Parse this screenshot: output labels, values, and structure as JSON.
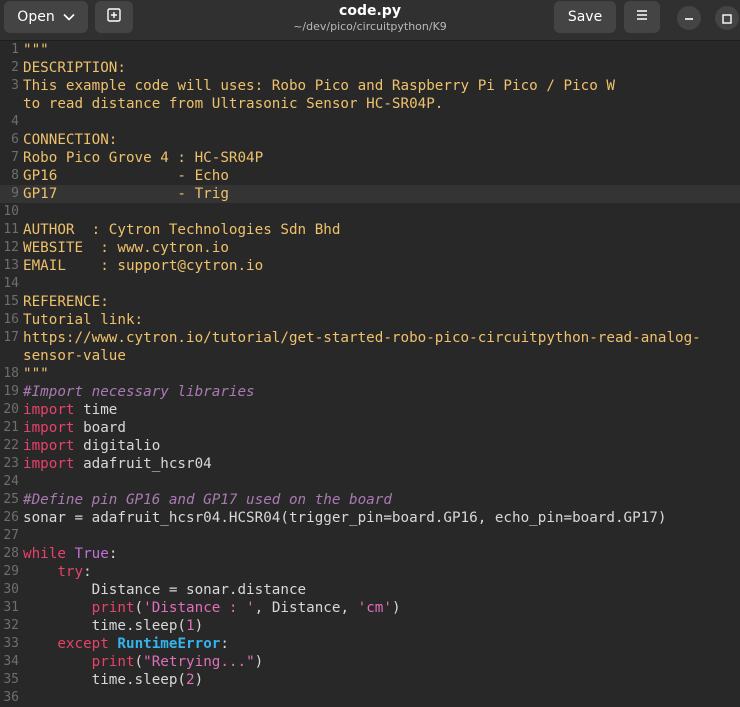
{
  "header": {
    "open_label": "Open",
    "save_label": "Save",
    "title": "code.py",
    "path": "~/dev/pico/circuitpython/K9"
  },
  "icons": {
    "open_dropdown": "chevron-down-icon",
    "new_tab": "new-tab-icon",
    "menu": "hamburger-menu-icon",
    "minimize": "minimize-icon",
    "maximize": "maximize-icon"
  },
  "colors": {
    "background": "#282828",
    "docstring": "#eec16c",
    "keyword": "#e8426a",
    "comment": "#a97ab2",
    "string": "#e070b8",
    "exception": "#33b4ec",
    "line_number": "#6e6e6e"
  },
  "editor": {
    "current_line": 9,
    "lines": [
      {
        "n": "1",
        "tokens": [
          {
            "t": "\"\"\"",
            "c": "doc"
          }
        ]
      },
      {
        "n": "2",
        "tokens": [
          {
            "t": "DESCRIPTION:",
            "c": "doc"
          }
        ]
      },
      {
        "n": "3",
        "tokens": [
          {
            "t": "This example code will uses: Robo Pico and Raspberry Pi Pico / Pico W",
            "c": "doc"
          }
        ]
      },
      {
        "n": "",
        "tokens": [
          {
            "t": "to read distance from Ultrasonic Sensor HC-SR04P.",
            "c": "doc"
          }
        ]
      },
      {
        "n": "4",
        "tokens": []
      },
      {
        "n": "6",
        "tokens": [
          {
            "t": "CONNECTION:",
            "c": "doc"
          }
        ]
      },
      {
        "n": "7",
        "tokens": [
          {
            "t": "Robo Pico Grove 4 : HC-SR04P",
            "c": "doc"
          }
        ]
      },
      {
        "n": "8",
        "tokens": [
          {
            "t": "GP16              - Echo",
            "c": "doc"
          }
        ]
      },
      {
        "n": "9",
        "tokens": [
          {
            "t": "GP17              - Trig",
            "c": "doc"
          }
        ]
      },
      {
        "n": "10",
        "tokens": []
      },
      {
        "n": "11",
        "tokens": [
          {
            "t": "AUTHOR  : Cytron Technologies Sdn Bhd",
            "c": "doc"
          }
        ]
      },
      {
        "n": "12",
        "tokens": [
          {
            "t": "WEBSITE  : www.cytron.io",
            "c": "doc"
          }
        ]
      },
      {
        "n": "13",
        "tokens": [
          {
            "t": "EMAIL    : support@cytron.io",
            "c": "doc"
          }
        ]
      },
      {
        "n": "14",
        "tokens": []
      },
      {
        "n": "15",
        "tokens": [
          {
            "t": "REFERENCE:",
            "c": "doc"
          }
        ]
      },
      {
        "n": "16",
        "tokens": [
          {
            "t": "Tutorial link:",
            "c": "doc"
          }
        ]
      },
      {
        "n": "17",
        "tokens": [
          {
            "t": "https://www.cytron.io/tutorial/get-started-robo-pico-circuitpython-read-analog-",
            "c": "doc"
          }
        ]
      },
      {
        "n": "",
        "tokens": [
          {
            "t": "sensor-value",
            "c": "doc"
          }
        ]
      },
      {
        "n": "18",
        "tokens": [
          {
            "t": "\"\"\"",
            "c": "doc"
          }
        ]
      },
      {
        "n": "19",
        "tokens": [
          {
            "t": "#Import necessary libraries",
            "c": "cm"
          }
        ]
      },
      {
        "n": "20",
        "tokens": [
          {
            "t": "import",
            "c": "kw"
          },
          {
            "t": " time",
            "c": ""
          }
        ]
      },
      {
        "n": "21",
        "tokens": [
          {
            "t": "import",
            "c": "kw"
          },
          {
            "t": " board",
            "c": ""
          }
        ]
      },
      {
        "n": "22",
        "tokens": [
          {
            "t": "import",
            "c": "kw"
          },
          {
            "t": " digitalio",
            "c": ""
          }
        ]
      },
      {
        "n": "23",
        "tokens": [
          {
            "t": "import",
            "c": "kw"
          },
          {
            "t": " adafruit_hcsr04",
            "c": ""
          }
        ]
      },
      {
        "n": "24",
        "tokens": []
      },
      {
        "n": "25",
        "tokens": [
          {
            "t": "#Define pin GP16 and GP17 used on the board",
            "c": "cm"
          }
        ]
      },
      {
        "n": "26",
        "tokens": [
          {
            "t": "sonar = adafruit_hcsr04.HCSR04(trigger_pin=board.GP16, echo_pin=board.GP17)",
            "c": ""
          }
        ]
      },
      {
        "n": "27",
        "tokens": []
      },
      {
        "n": "28",
        "tokens": [
          {
            "t": "while",
            "c": "kw"
          },
          {
            "t": " ",
            "c": ""
          },
          {
            "t": "True",
            "c": "kw2"
          },
          {
            "t": ":",
            "c": ""
          }
        ]
      },
      {
        "n": "29",
        "tokens": [
          {
            "t": "    ",
            "c": ""
          },
          {
            "t": "try",
            "c": "kw"
          },
          {
            "t": ":",
            "c": ""
          }
        ]
      },
      {
        "n": "30",
        "tokens": [
          {
            "t": "        Distance = sonar.distance",
            "c": ""
          }
        ]
      },
      {
        "n": "31",
        "tokens": [
          {
            "t": "        ",
            "c": ""
          },
          {
            "t": "print",
            "c": "kw"
          },
          {
            "t": "(",
            "c": ""
          },
          {
            "t": "'Distance : '",
            "c": "str"
          },
          {
            "t": ", Distance, ",
            "c": ""
          },
          {
            "t": "'cm'",
            "c": "str"
          },
          {
            "t": ")",
            "c": ""
          }
        ]
      },
      {
        "n": "32",
        "tokens": [
          {
            "t": "        time.sleep(",
            "c": ""
          },
          {
            "t": "1",
            "c": "num"
          },
          {
            "t": ")",
            "c": ""
          }
        ]
      },
      {
        "n": "33",
        "tokens": [
          {
            "t": "    ",
            "c": ""
          },
          {
            "t": "except",
            "c": "kw"
          },
          {
            "t": " ",
            "c": ""
          },
          {
            "t": "RuntimeError",
            "c": "exc"
          },
          {
            "t": ":",
            "c": ""
          }
        ]
      },
      {
        "n": "34",
        "tokens": [
          {
            "t": "        ",
            "c": ""
          },
          {
            "t": "print",
            "c": "kw"
          },
          {
            "t": "(",
            "c": ""
          },
          {
            "t": "\"Retrying...\"",
            "c": "str"
          },
          {
            "t": ")",
            "c": ""
          }
        ]
      },
      {
        "n": "35",
        "tokens": [
          {
            "t": "        time.sleep(",
            "c": ""
          },
          {
            "t": "2",
            "c": "num"
          },
          {
            "t": ")",
            "c": ""
          }
        ]
      },
      {
        "n": "36",
        "tokens": []
      }
    ]
  }
}
